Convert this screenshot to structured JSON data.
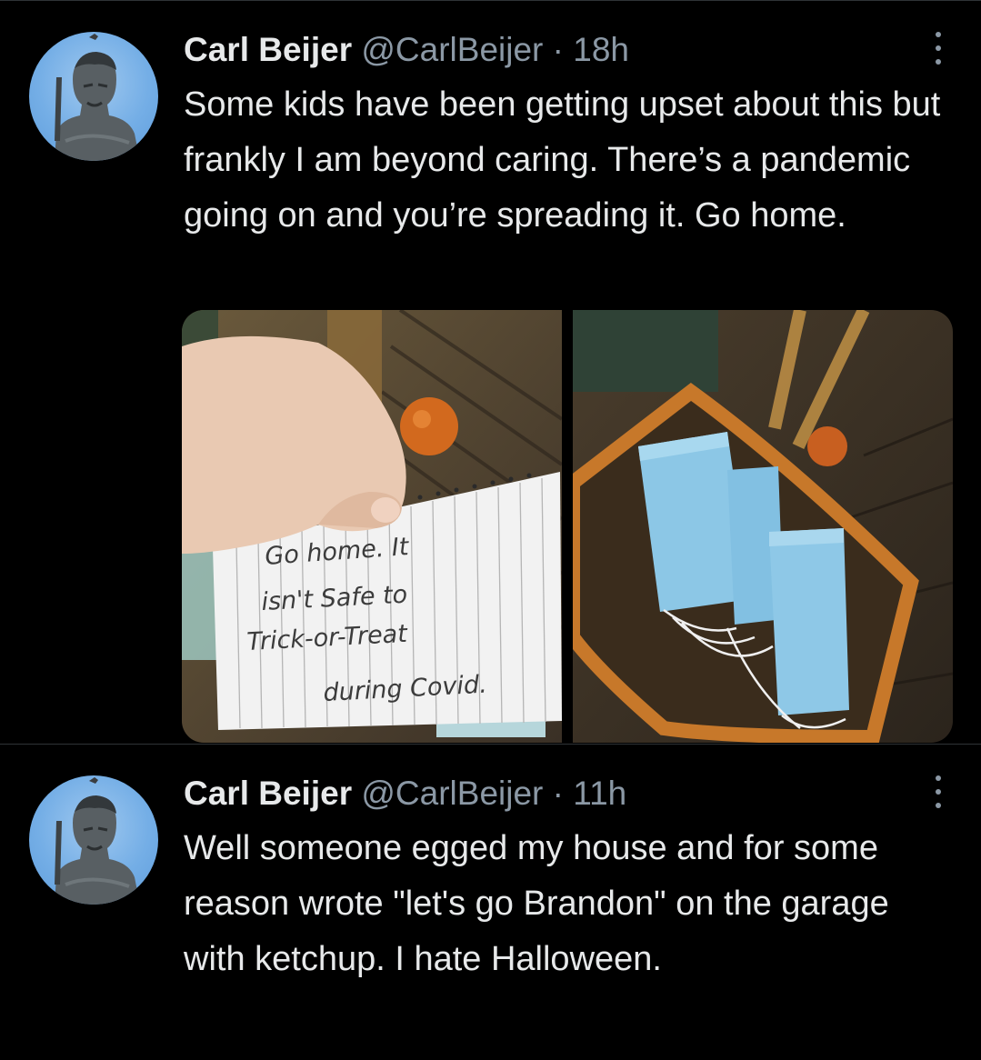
{
  "tweets": [
    {
      "name": "Carl Beijer",
      "handle": "@CarlBeijer",
      "separator": "·",
      "time": "18h",
      "text": "Some kids have been getting upset about this but frankly I am beyond caring. There’s a pandemic going on and you’re spreading it. Go home.",
      "note_lines": [
        "Go home. It",
        "isn't Safe to",
        "Trick-or-Treat",
        "during Covid."
      ]
    },
    {
      "name": "Carl Beijer",
      "handle": "@CarlBeijer",
      "separator": "·",
      "time": "11h",
      "text": "Well someone egged my house and for some reason wrote \"let's go Brandon\" on the garage with ketchup. I hate Halloween."
    }
  ],
  "icons": {
    "more": "more-options-icon",
    "avatar": "statue-avatar"
  },
  "colors": {
    "background": "#000000",
    "text": "#e7e9ea",
    "secondary": "#8b98a5",
    "divider": "#2f3336"
  }
}
